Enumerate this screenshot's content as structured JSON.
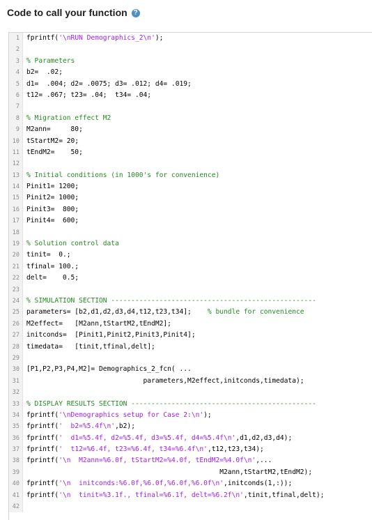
{
  "header": {
    "title": "Code to call your function",
    "help_icon": "question-circle-icon"
  },
  "colors": {
    "comment": "#228b22",
    "string": "#a020f0",
    "text": "#000000",
    "accent": "#4d90cf"
  },
  "lines": [
    [
      [
        "t",
        "fprintf("
      ],
      [
        "s",
        "'\\nRUN Demographics_2\\n'"
      ],
      [
        "t",
        ");"
      ]
    ],
    [],
    [
      [
        "c",
        "% Parameters"
      ]
    ],
    [
      [
        "t",
        "b2=  .02;"
      ]
    ],
    [
      [
        "t",
        "d1=  .004; d2= .0075; d3= .012; d4= .019;"
      ]
    ],
    [
      [
        "t",
        "t12= .067; t23= .04;  t34= .04;"
      ]
    ],
    [],
    [
      [
        "c",
        "% Migration effect M2"
      ]
    ],
    [
      [
        "t",
        "M2ann=     80;"
      ]
    ],
    [
      [
        "t",
        "tStartM2= 20;"
      ]
    ],
    [
      [
        "t",
        "tEndM2=    50;"
      ]
    ],
    [],
    [
      [
        "c",
        "% Initial conditions (in 1000's for convenience)"
      ]
    ],
    [
      [
        "t",
        "Pinit1= 1200;"
      ]
    ],
    [
      [
        "t",
        "Pinit2= 1000;"
      ]
    ],
    [
      [
        "t",
        "Pinit3=  800;"
      ]
    ],
    [
      [
        "t",
        "Pinit4=  600;"
      ]
    ],
    [],
    [
      [
        "c",
        "% Solution control data"
      ]
    ],
    [
      [
        "t",
        "tinit=  0.;"
      ]
    ],
    [
      [
        "t",
        "tfinal= 100.;"
      ]
    ],
    [
      [
        "t",
        "delt=    0.5;"
      ]
    ],
    [],
    [
      [
        "c",
        "% SIMULATION SECTION ---------------------------------------------------"
      ]
    ],
    [
      [
        "t",
        "parameters= [b2,d1,d2,d3,d4,t12,t23,t34];    "
      ],
      [
        "c",
        "% bundle for convenience"
      ]
    ],
    [
      [
        "t",
        "M2effect=   [M2ann,tStartM2,tEndM2];"
      ]
    ],
    [
      [
        "t",
        "initconds=  [Pinit1,Pinit2,Pinit3,Pinit4];"
      ]
    ],
    [
      [
        "t",
        "timedata=   [tinit,tfinal,delt];"
      ]
    ],
    [],
    [
      [
        "t",
        "[P1,P2,P3,P4,M2]= Demographics_2_fcn( ..."
      ]
    ],
    [
      [
        "t",
        "                             parameters,M2effect,initconds,timedata);"
      ]
    ],
    [],
    [
      [
        "c",
        "% DISPLAY RESULTS SECTION ----------------------------------------------"
      ]
    ],
    [
      [
        "t",
        "fprintf("
      ],
      [
        "s",
        "'\\nDemographics setup for Case 2:\\n'"
      ],
      [
        "t",
        ");"
      ]
    ],
    [
      [
        "t",
        "fprintf("
      ],
      [
        "s",
        "'  b2=%5.4f\\n'"
      ],
      [
        "t",
        ",b2);"
      ]
    ],
    [
      [
        "t",
        "fprintf("
      ],
      [
        "s",
        "'  d1=%5.4f, d2=%5.4f, d3=%5.4f, d4=%5.4f\\n'"
      ],
      [
        "t",
        ",d1,d2,d3,d4);"
      ]
    ],
    [
      [
        "t",
        "fprintf("
      ],
      [
        "s",
        "'  t12=%6.4f, t23=%6.4f, t34=%6.4f\\n'"
      ],
      [
        "t",
        ",t12,t23,t34);"
      ]
    ],
    [
      [
        "t",
        "fprintf("
      ],
      [
        "s",
        "'\\n  M2ann=%6.0f, tStartM2=%4.0f, tEndM2=%4.0f\\n'"
      ],
      [
        "t",
        ",..."
      ]
    ],
    [
      [
        "t",
        "                                                M2ann,tStartM2,tEndM2);"
      ]
    ],
    [
      [
        "t",
        "fprintf("
      ],
      [
        "s",
        "'\\n  initconds:%6.0f,%6.0f,%6.0f,%6.0f\\n'"
      ],
      [
        "t",
        ",initconds(1,:));"
      ]
    ],
    [
      [
        "t",
        "fprintf("
      ],
      [
        "s",
        "'\\n  tinit=%3.1f., tfinal=%6.1f, delt=%6.2f\\n'"
      ],
      [
        "t",
        ",tinit,tfinal,delt);"
      ]
    ],
    []
  ]
}
